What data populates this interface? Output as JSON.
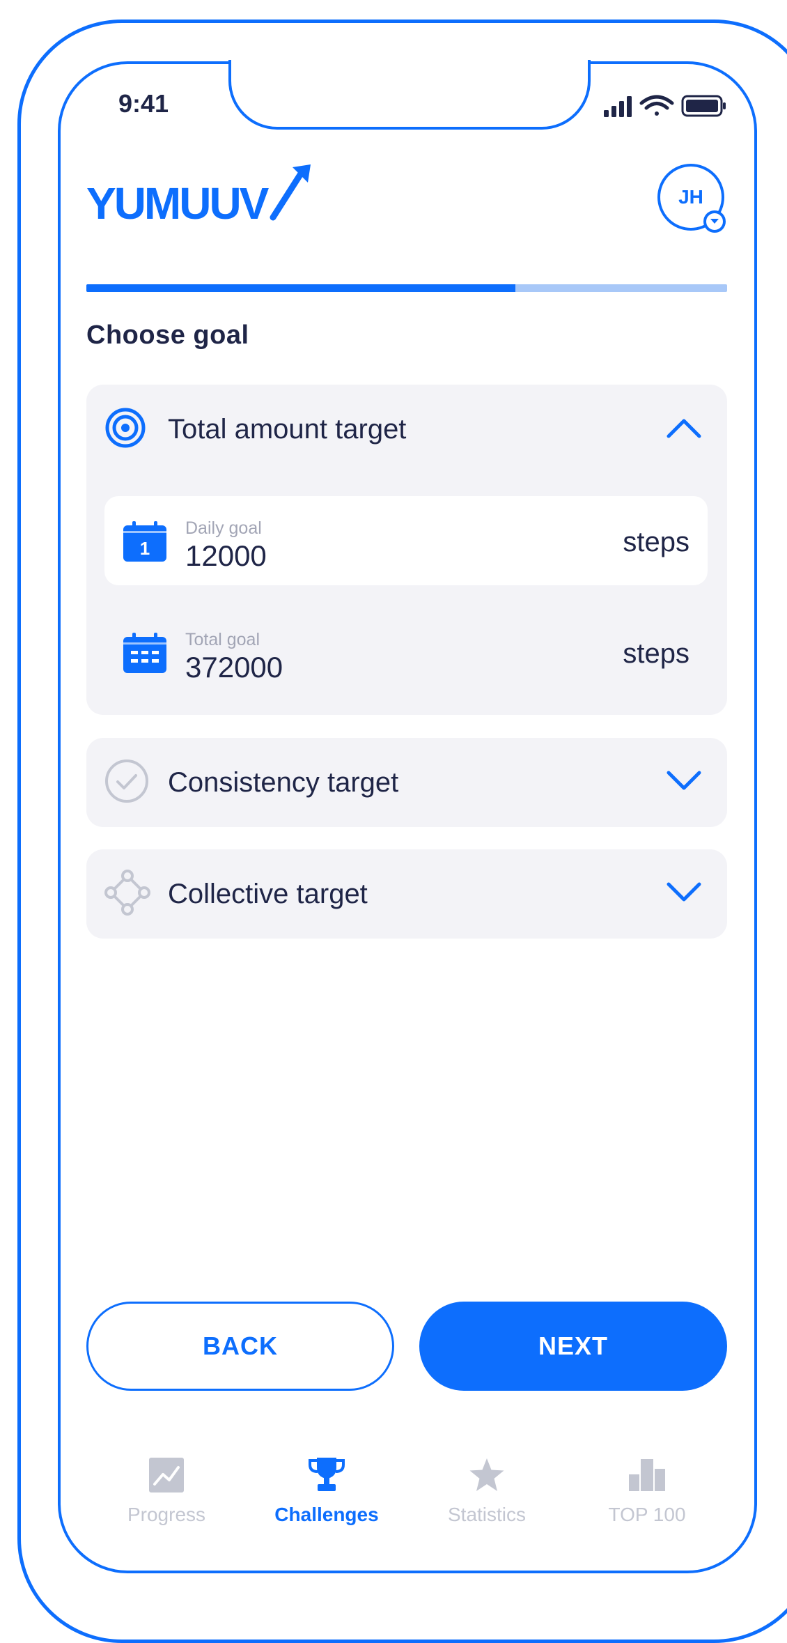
{
  "status_bar": {
    "time": "9:41"
  },
  "header": {
    "logo_text": "YUMUUV",
    "avatar_initials": "JH"
  },
  "progress": {
    "value": 0.67
  },
  "page": {
    "title": "Choose goal"
  },
  "goal_options": [
    {
      "label": "Total amount target",
      "expanded": true,
      "icon": "target-icon",
      "fields": [
        {
          "label": "Daily goal",
          "value": "12000",
          "unit": "steps",
          "icon": "calendar-day-icon",
          "selected": true
        },
        {
          "label": "Total goal",
          "value": "372000",
          "unit": "steps",
          "icon": "calendar-month-icon",
          "selected": false
        }
      ]
    },
    {
      "label": "Consistency target",
      "expanded": false,
      "icon": "check-circle-icon"
    },
    {
      "label": "Collective target",
      "expanded": false,
      "icon": "group-nodes-icon"
    }
  ],
  "buttons": {
    "back": "BACK",
    "next": "NEXT"
  },
  "tabbar": {
    "items": [
      {
        "label": "Progress",
        "icon": "chart-icon",
        "active": false
      },
      {
        "label": "Challenges",
        "icon": "trophy-icon",
        "active": true
      },
      {
        "label": "Statistics",
        "icon": "star-icon",
        "active": false
      },
      {
        "label": "TOP 100",
        "icon": "podium-icon",
        "active": false
      }
    ]
  },
  "colors": {
    "accent": "#0d6efd",
    "accent_light": "#a8c8f8",
    "text_dark": "#1f2547",
    "text_muted": "#a2a5b5",
    "card_bg": "#f3f3f7",
    "inactive_icon": "#c3c6d1"
  }
}
